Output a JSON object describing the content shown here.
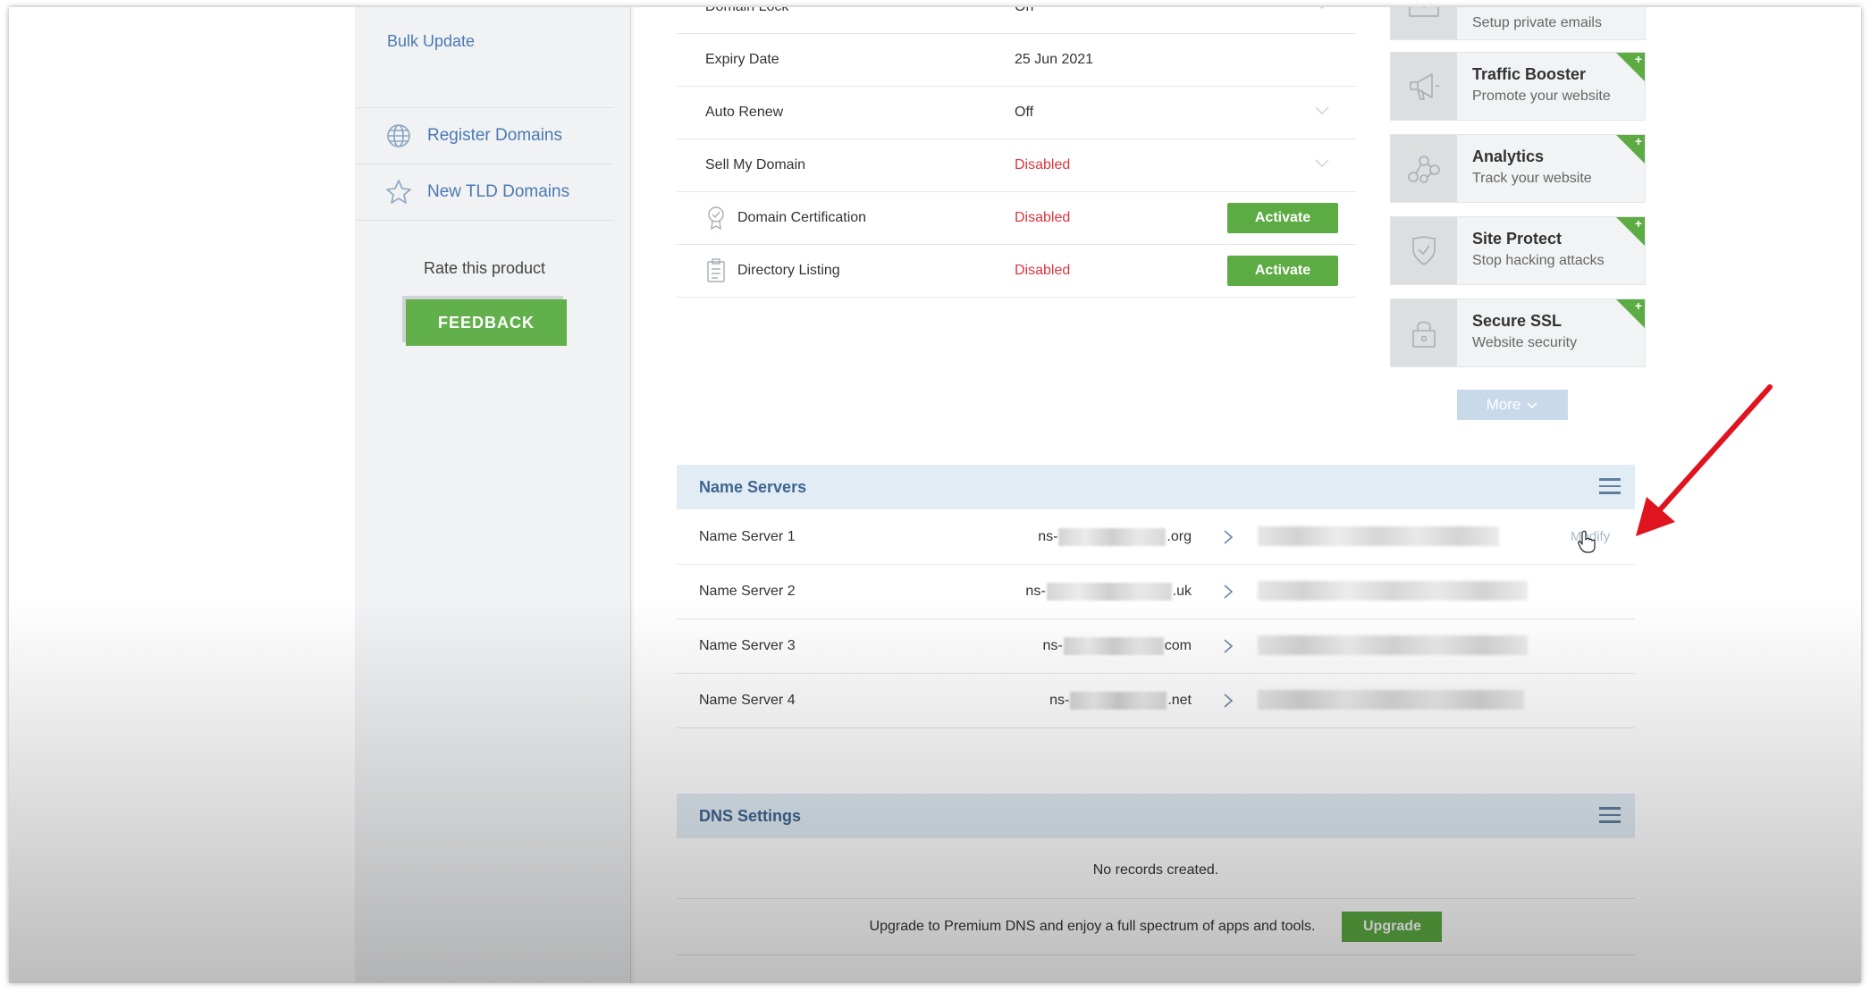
{
  "sidebar": {
    "bulk_update": "Bulk Update",
    "nav": [
      {
        "label": "Register Domains",
        "icon": "globe-icon"
      },
      {
        "label": "New TLD Domains",
        "icon": "star-icon"
      }
    ],
    "rate_label": "Rate this product",
    "feedback_label": "FEEDBACK"
  },
  "details": {
    "rows": [
      {
        "label": "Domain Lock",
        "value": "On",
        "status": "normal"
      },
      {
        "label": "Expiry Date",
        "value": "25 Jun 2021",
        "status": "normal"
      },
      {
        "label": "Auto Renew",
        "value": "Off",
        "status": "normal"
      },
      {
        "label": "Sell My Domain",
        "value": "Disabled",
        "status": "disabled"
      },
      {
        "label": "Domain Certification",
        "value": "Disabled",
        "status": "disabled",
        "icon": "certificate-icon",
        "action": "Activate"
      },
      {
        "label": "Directory Listing",
        "value": "Disabled",
        "status": "disabled",
        "icon": "clipboard-icon",
        "action": "Activate"
      }
    ]
  },
  "promo": {
    "cards": [
      {
        "title": "",
        "subtitle": "Setup private emails",
        "icon": "envelope-icon"
      },
      {
        "title": "Traffic Booster",
        "subtitle": "Promote your website",
        "icon": "megaphone-icon"
      },
      {
        "title": "Analytics",
        "subtitle": "Track your website",
        "icon": "nodes-icon"
      },
      {
        "title": "Site Protect",
        "subtitle": "Stop hacking attacks",
        "icon": "shield-icon"
      },
      {
        "title": "Secure SSL",
        "subtitle": "Website security",
        "icon": "lock-icon"
      }
    ],
    "plus_label": "+",
    "more_label": "More"
  },
  "name_servers": {
    "title": "Name Servers",
    "rows": [
      {
        "label": "Name Server 1",
        "prefix": "ns-",
        "suffix": ".org"
      },
      {
        "label": "Name Server 2",
        "prefix": "ns-",
        "suffix": ".uk"
      },
      {
        "label": "Name Server 3",
        "prefix": "ns-",
        "suffix": "com"
      },
      {
        "label": "Name Server 4",
        "prefix": "ns-",
        "suffix": ".net"
      }
    ],
    "modify_label": "Modify"
  },
  "dns": {
    "title": "DNS Settings",
    "empty_text": "No records created.",
    "upgrade_text": "Upgrade to Premium DNS and enjoy a full spectrum of apps and tools.",
    "upgrade_label": "Upgrade"
  },
  "colors": {
    "accent_green": "#5cab43",
    "link_blue": "#4a7ab3",
    "disabled_red": "#d9363e",
    "header_bg": "#e2ecf5",
    "annotation_arrow": "#e0141e"
  }
}
